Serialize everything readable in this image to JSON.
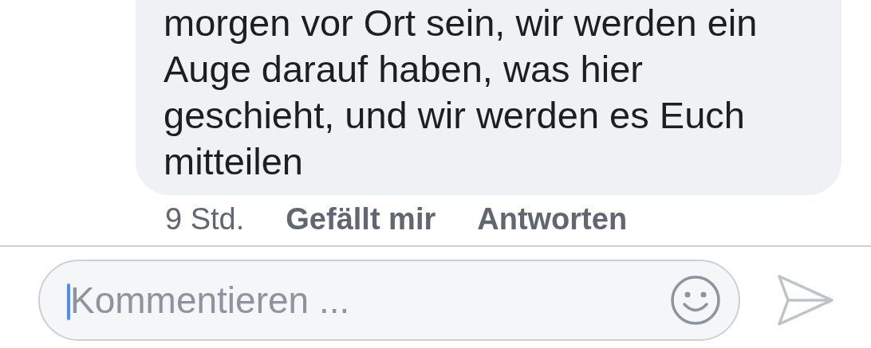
{
  "comment": {
    "text": "morgen vor Ort sein, wir werden ein Auge darauf haben, was hier geschieht, und wir werden es Euch mitteilen",
    "time": "9 Std.",
    "actions": [
      "Gefällt mir",
      "Antworten"
    ]
  },
  "composer": {
    "placeholder": "Kommentieren ...",
    "focused": true
  }
}
